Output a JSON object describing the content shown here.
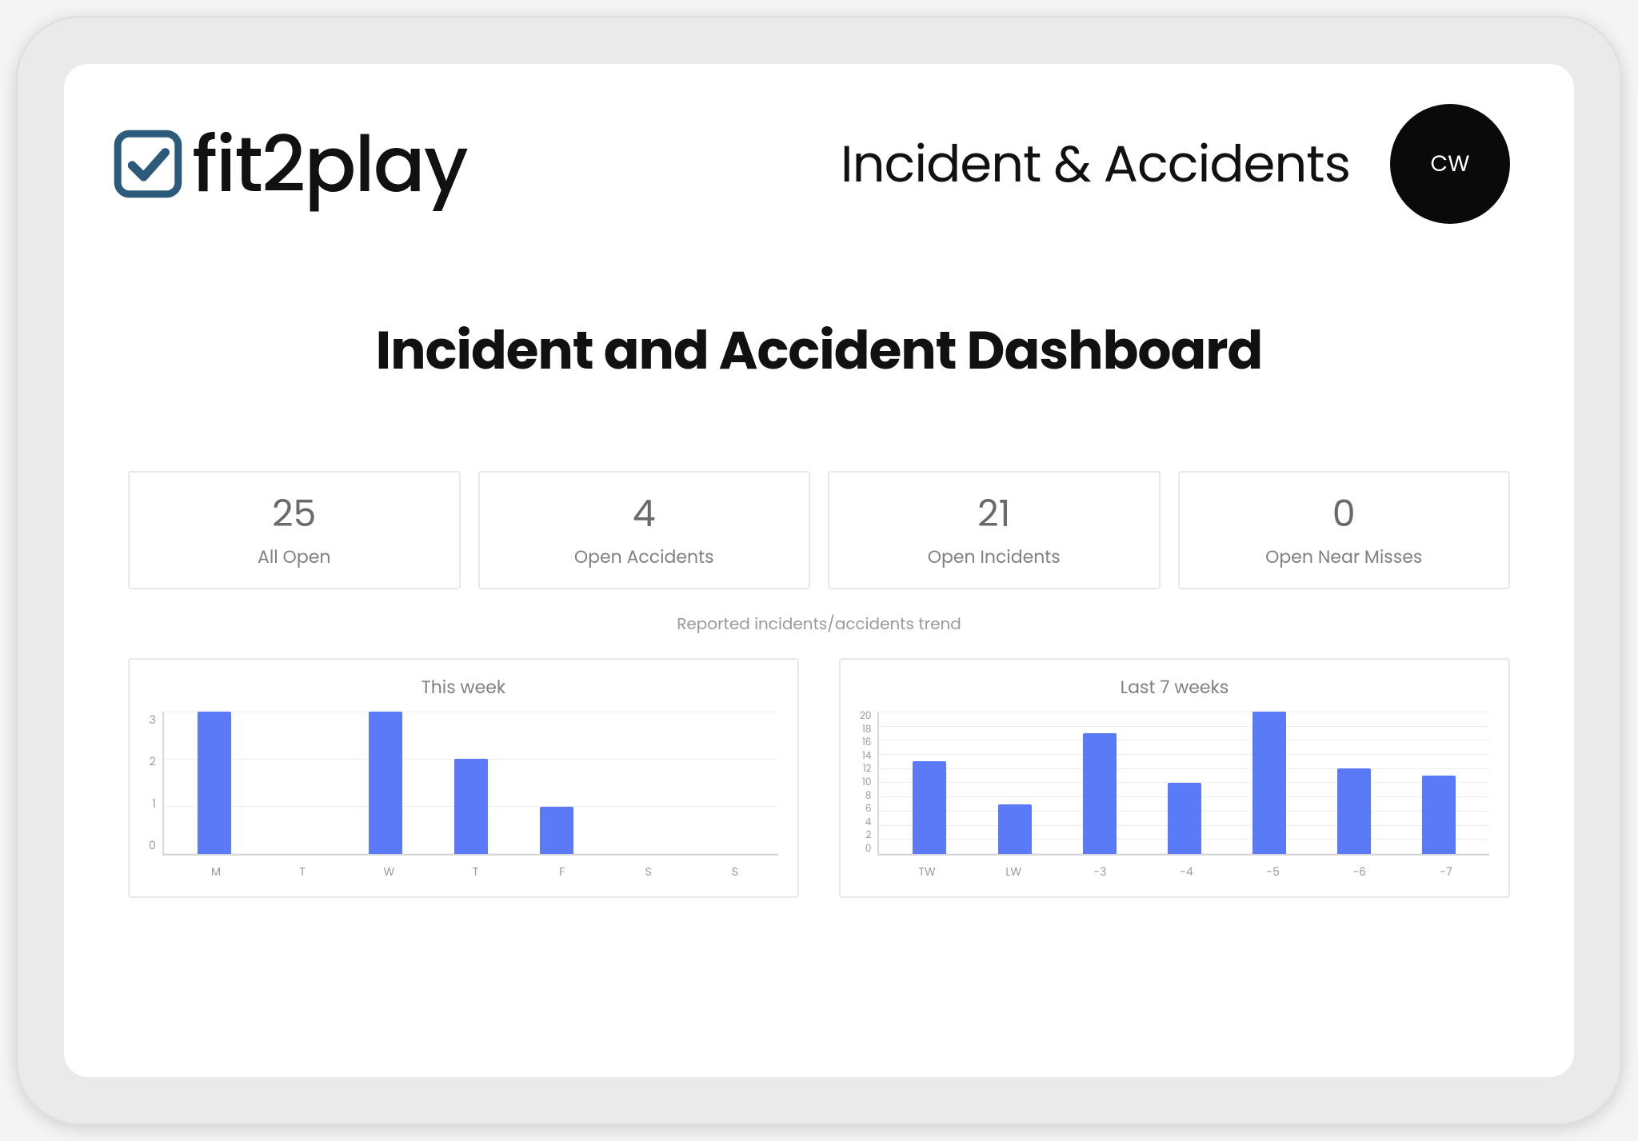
{
  "logo_text": "fit2play",
  "header": {
    "title": "Incident & Accidents",
    "avatar_initials": "CW"
  },
  "dashboard_title": "Incident and Accident Dashboard",
  "stats": [
    {
      "value": "25",
      "label": "All Open"
    },
    {
      "value": "4",
      "label": "Open Accidents"
    },
    {
      "value": "21",
      "label": "Open Incidents"
    },
    {
      "value": "0",
      "label": "Open Near Misses"
    }
  ],
  "trend_title": "Reported incidents/accidents trend",
  "chart_data": [
    {
      "type": "bar",
      "title": "This week",
      "categories": [
        "M",
        "T",
        "W",
        "T",
        "F",
        "S",
        "S"
      ],
      "values": [
        3,
        0,
        3,
        2,
        1,
        0,
        0
      ],
      "ylim": [
        0,
        3
      ],
      "yticks": [
        0,
        1,
        2,
        3
      ],
      "xlabel": "",
      "ylabel": ""
    },
    {
      "type": "bar",
      "title": "Last 7 weeks",
      "categories": [
        "TW",
        "LW",
        "-3",
        "-4",
        "-5",
        "-6",
        "-7"
      ],
      "values": [
        13,
        7,
        17,
        10,
        20,
        12,
        11
      ],
      "ylim": [
        0,
        20
      ],
      "yticks": [
        0,
        2,
        4,
        6,
        8,
        10,
        12,
        14,
        16,
        18,
        20
      ],
      "xlabel": "",
      "ylabel": ""
    }
  ],
  "colors": {
    "bar": "#5a7af8",
    "logo_accent": "#2b5a7a"
  }
}
